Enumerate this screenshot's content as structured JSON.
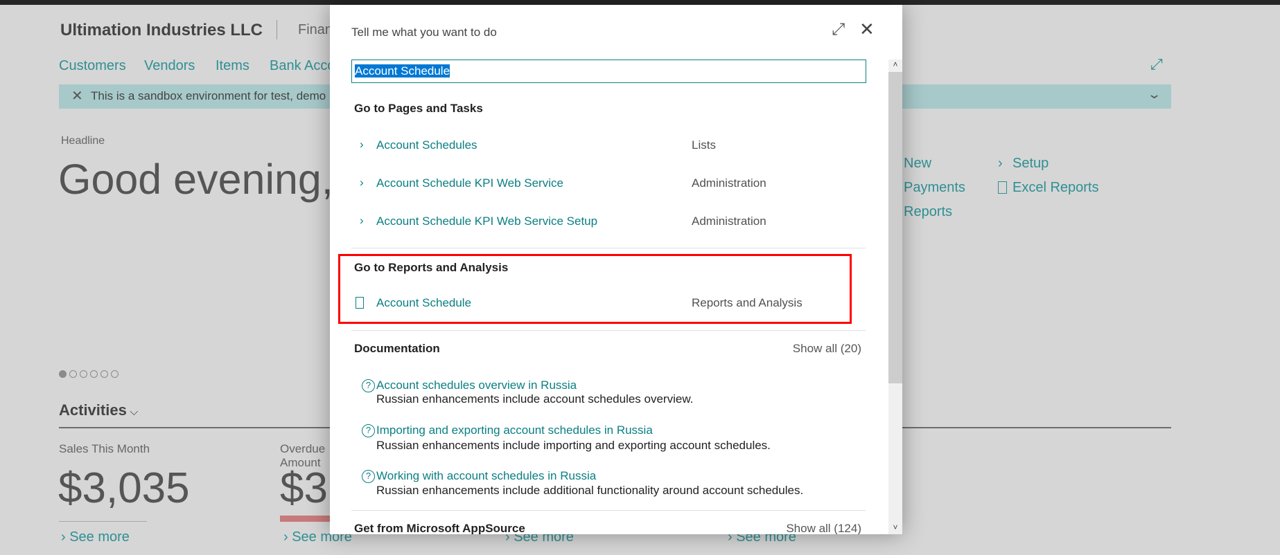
{
  "app": {
    "company": "Ultimation Industries LLC",
    "role_center": "Finan"
  },
  "nav": [
    "Customers",
    "Vendors",
    "Items",
    "Bank Acco"
  ],
  "banner": {
    "text": "This is a sandbox environment for test, demo"
  },
  "headline": {
    "label": "Headline",
    "greeting": "Good evening,"
  },
  "actions": {
    "col1": [
      "New",
      "Payments",
      "Reports"
    ],
    "setup": "Setup",
    "excel": "Excel Reports"
  },
  "activities": {
    "title": "Activities",
    "tiles": [
      {
        "label": "Sales This Month",
        "value": "$3,035"
      },
      {
        "label1": "Overdue",
        "label2": "Amount",
        "value": "$3"
      }
    ],
    "see_more": "See more"
  },
  "carousel": {
    "count": 6,
    "active": 0
  },
  "dialog": {
    "title": "Tell me what you want to do",
    "search_value": "Account Schedule",
    "pages_heading": "Go to Pages and Tasks",
    "pages": [
      {
        "label": "Account Schedules",
        "category": "Lists"
      },
      {
        "label": "Account Schedule KPI Web Service",
        "category": "Administration"
      },
      {
        "label": "Account Schedule KPI Web Service Setup",
        "category": "Administration"
      }
    ],
    "reports_heading": "Go to Reports and Analysis",
    "reports": [
      {
        "label": "Account Schedule",
        "category": "Reports and Analysis"
      }
    ],
    "docs_heading": "Documentation",
    "docs_show_all": "Show all (20)",
    "docs": [
      {
        "title": "Account schedules overview in Russia",
        "desc": "Russian enhancements include account schedules overview."
      },
      {
        "title": "Importing and exporting account schedules in Russia",
        "desc": "Russian enhancements include importing and exporting account schedules."
      },
      {
        "title": "Working with account schedules in Russia",
        "desc": "Russian enhancements include additional functionality around account schedules."
      }
    ],
    "appsource_heading": "Get from Microsoft AppSource",
    "appsource_show_all": "Show all (124)"
  },
  "colors": {
    "highlight_box": "#ff0000",
    "accent": "#0a7f82",
    "selection": "#0078d4"
  }
}
